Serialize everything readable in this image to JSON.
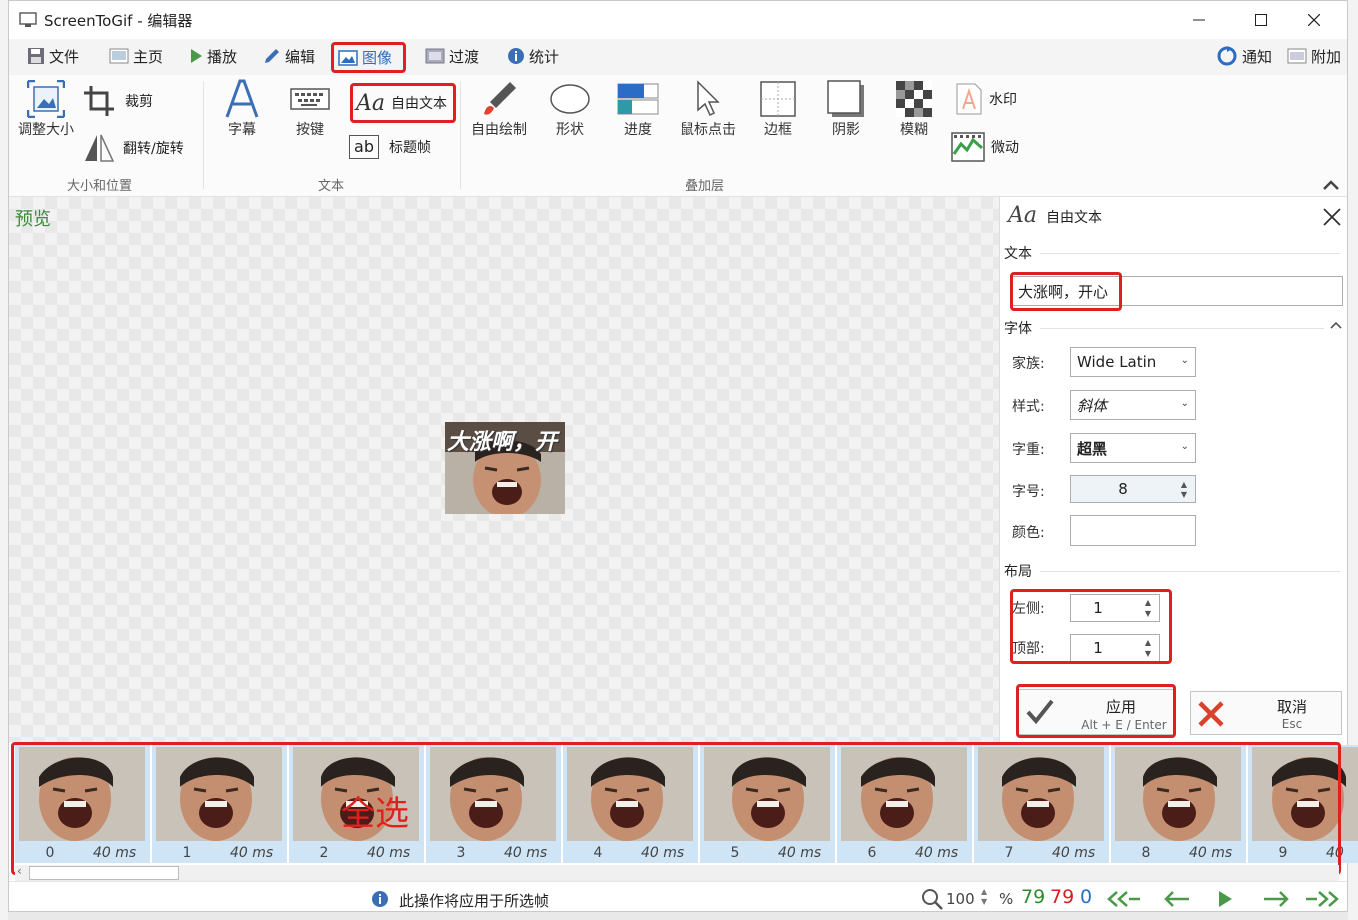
{
  "window": {
    "title": "ScreenToGif - 编辑器",
    "min_icon": "minimize-icon",
    "max_icon": "maximize-icon",
    "close_icon": "close-icon"
  },
  "tabs": [
    {
      "label": "文件",
      "icon": "save-icon"
    },
    {
      "label": "主页",
      "icon": "home-icon"
    },
    {
      "label": "播放",
      "icon": "play-icon"
    },
    {
      "label": "编辑",
      "icon": "pencil-icon"
    },
    {
      "label": "图像",
      "icon": "image-icon",
      "selected": true
    },
    {
      "label": "过渡",
      "icon": "transition-icon"
    },
    {
      "label": "统计",
      "icon": "info-icon"
    }
  ],
  "topright": {
    "notify": "通知",
    "extras": "附加"
  },
  "ribbon": {
    "size_group": {
      "label": "大小和位置",
      "resize": "调整大小",
      "crop": "裁剪",
      "flip_rotate": "翻转/旋转"
    },
    "text_group": {
      "label": "文本",
      "caption": "字幕",
      "keystrokes": "按键",
      "free_text": "自由文本",
      "title_frame": "标题帧",
      "free_text_glyph": "Aa",
      "title_frame_glyph": "ab"
    },
    "overlay_group": {
      "label": "叠加层",
      "free_drawing": "自由绘制",
      "shapes": "形状",
      "progress": "进度",
      "mouse_clicks": "鼠标点击",
      "border": "边框",
      "shadow": "阴影",
      "obfuscate": "模糊",
      "watermark": "水印",
      "cinemagraph": "微动"
    }
  },
  "preview": {
    "label": "预览",
    "overlay_text": "大涨啊，开"
  },
  "panel": {
    "title": "自由文本",
    "title_glyph": "Aa",
    "text_section": "文本",
    "text_value": "大涨啊，开心",
    "font_section": "字体",
    "family_label": "家族:",
    "family_value": "Wide Latin",
    "style_label": "样式:",
    "style_value": "斜体",
    "weight_label": "字重:",
    "weight_value": "超黑",
    "size_label": "字号:",
    "size_value": "8",
    "color_label": "颜色:",
    "layout_section": "布局",
    "left_label": "左侧:",
    "left_value": "1",
    "top_label": "顶部:",
    "top_value": "1",
    "apply_label": "应用",
    "apply_shortcut": "Alt + E / Enter",
    "cancel_label": "取消",
    "cancel_shortcut": "Esc"
  },
  "frames": [
    {
      "index": "0",
      "delay": "40 ms"
    },
    {
      "index": "1",
      "delay": "40 ms"
    },
    {
      "index": "2",
      "delay": "40 ms"
    },
    {
      "index": "3",
      "delay": "40 ms"
    },
    {
      "index": "4",
      "delay": "40 ms"
    },
    {
      "index": "5",
      "delay": "40 ms"
    },
    {
      "index": "6",
      "delay": "40 ms"
    },
    {
      "index": "7",
      "delay": "40 ms"
    },
    {
      "index": "8",
      "delay": "40 ms"
    },
    {
      "index": "9",
      "delay": "40"
    }
  ],
  "annotation": {
    "select_all": "全选"
  },
  "status": {
    "message": "此操作将应用于所选帧",
    "zoom": "100",
    "zoom_unit": "%",
    "total": "79",
    "selected": "79",
    "current": "0"
  },
  "colors": {
    "accent": "#2b6cc4",
    "highlight": "#e02020",
    "frame_bg": "#cfe5f5",
    "green": "#2e8b2e",
    "red": "#d42020",
    "blue": "#2b6cc4"
  }
}
